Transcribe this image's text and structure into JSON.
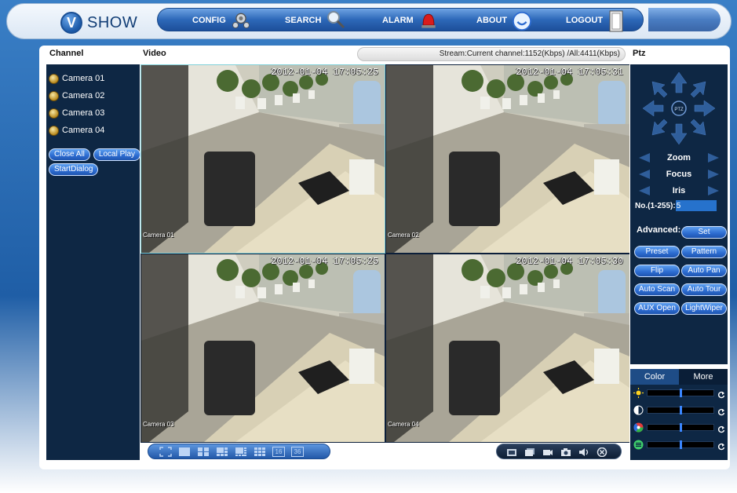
{
  "logo": {
    "mark": "V",
    "text": "SHOW"
  },
  "nav": [
    {
      "label": "CONFIG",
      "icon": "config-gears-icon"
    },
    {
      "label": "SEARCH",
      "icon": "magnifier-icon"
    },
    {
      "label": "ALARM",
      "icon": "siren-icon"
    },
    {
      "label": "ABOUT",
      "icon": "smiley-icon"
    },
    {
      "label": "LOGOUT",
      "icon": "door-icon"
    }
  ],
  "headers": {
    "channel": "Channel",
    "video": "Video",
    "ptz": "Ptz"
  },
  "stream": "Stream:Current channel:1152(Kbps) /All:4411(Kbps)",
  "cameras": [
    "Camera 01",
    "Camera 02",
    "Camera 03",
    "Camera 04"
  ],
  "channel_buttons": {
    "close_all": "Close All",
    "local_play": "Local Play",
    "start_dialog": "StartDialog"
  },
  "tiles": [
    {
      "label": "Camera 01",
      "timestamp": "2012-01-04 17:05:25",
      "selected": true
    },
    {
      "label": "Camera 02",
      "timestamp": "2012-01-04 17:05:31",
      "selected": false
    },
    {
      "label": "Camera 03",
      "timestamp": "2012-01-04 17:05:25",
      "selected": false
    },
    {
      "label": "Camera 04",
      "timestamp": "2012-01-04 17:05:30",
      "selected": false
    }
  ],
  "ptz": {
    "center_label": "PTZ",
    "zoom": "Zoom",
    "focus": "Focus",
    "iris": "Iris",
    "number_label": "No.(1-255):",
    "number_value": "5",
    "advanced_label": "Advanced:",
    "buttons": {
      "set": "Set",
      "preset": "Preset",
      "pattern": "Pattern",
      "flip": "Flip",
      "auto_pan": "Auto Pan",
      "auto_scan": "Auto Scan",
      "auto_tour": "Auto Tour",
      "aux_open": "AUX Open",
      "light_wiper": "LightWiper"
    }
  },
  "color_tabs": {
    "color": "Color",
    "more": "More"
  },
  "color_sliders": [
    {
      "name": "brightness",
      "icon": "sun-icon",
      "value": 0.5
    },
    {
      "name": "contrast",
      "icon": "contrast-icon",
      "value": 0.5
    },
    {
      "name": "saturation",
      "icon": "color-wheel-icon",
      "value": 0.5
    },
    {
      "name": "hue",
      "icon": "hue-icon",
      "value": 0.5
    }
  ],
  "layout_buttons": [
    "fullscreen-icon",
    "layout-1-icon",
    "layout-4-icon",
    "layout-6-icon",
    "layout-8-icon",
    "layout-9-icon",
    "layout-16-icon",
    "layout-36-icon"
  ],
  "layout_numbers": {
    "l16": "16",
    "l36": "36"
  },
  "action_buttons": [
    "snapshot-icon",
    "record-icon",
    "video-icon",
    "camera-icon",
    "audio-icon",
    "close-icon"
  ],
  "colors": {
    "accent": "#2c6bd0",
    "panel": "#0e2744",
    "nav": "#2d68b8"
  }
}
